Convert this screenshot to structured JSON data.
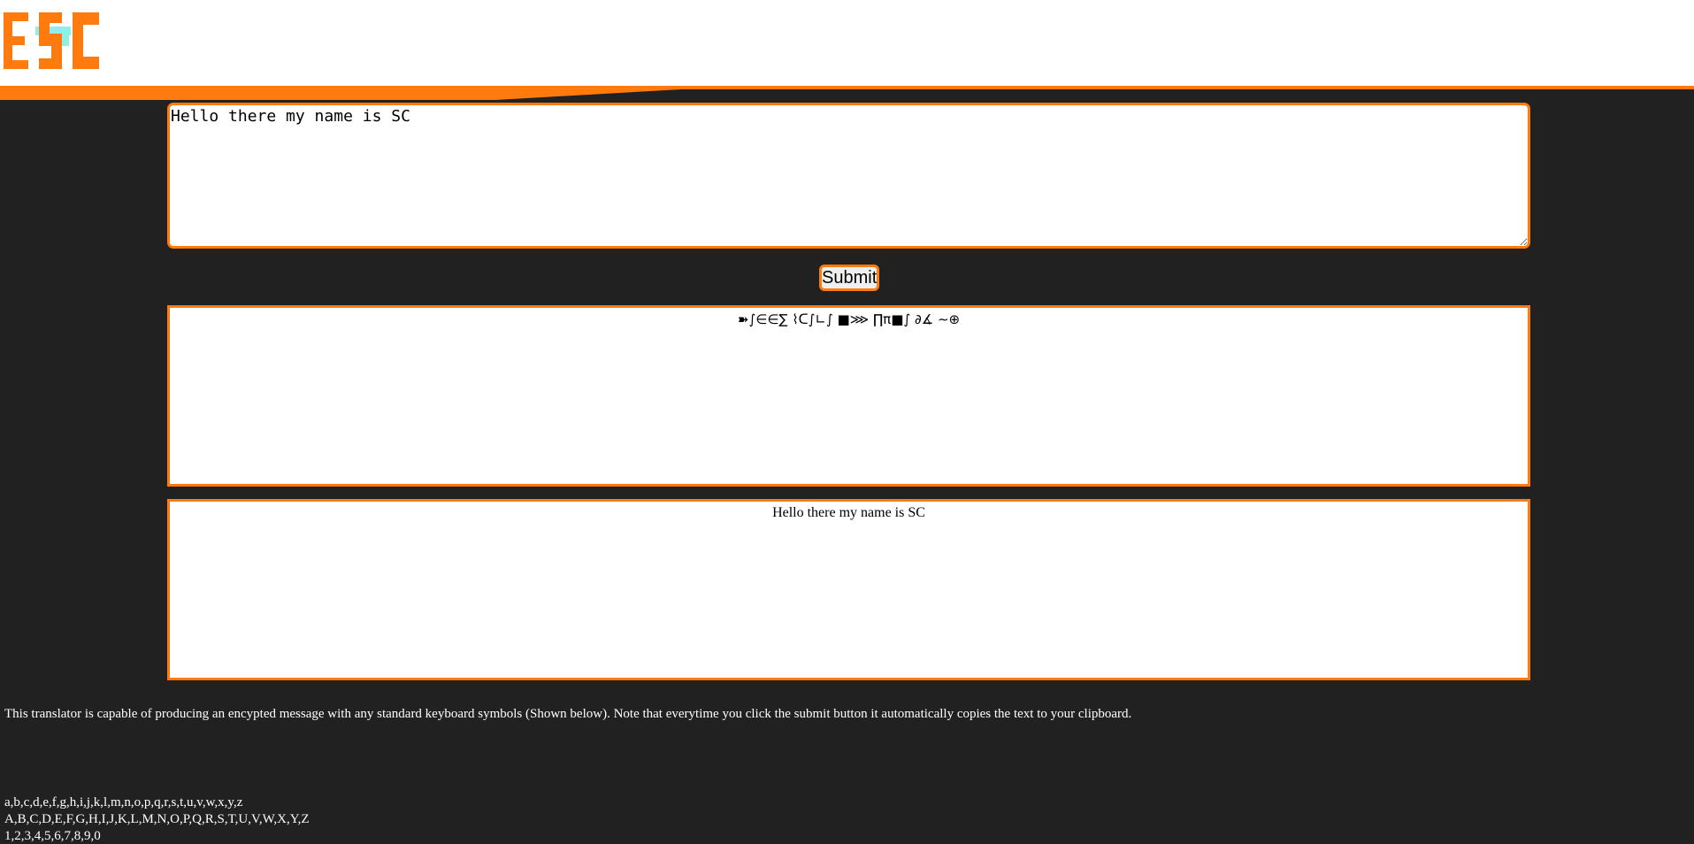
{
  "header": {
    "logo_text": "ESC",
    "colors": {
      "accent": "#ff7b0f",
      "logo_shadow": "#8ff0e6",
      "background": "#212121"
    }
  },
  "translator": {
    "input_value": "Hello there my name is SC",
    "submit_label": "Submit",
    "encrypted_output": "➽∫∈∈∑ ⌇ᑕ∫∟∫ ■⋙ ∏π■∫ ∂∡ ∼⊕",
    "decrypted_output": "Hello there my name is SC"
  },
  "info": {
    "description": "This translator is capable of producing an encypted message with any standard keyboard symbols (Shown below). Note that everytime you click the submit button it automatically copies the text to your clipboard.",
    "lowercase": "a,b,c,d,e,f,g,h,i,j,k,l,m,n,o,p,q,r,s,t,u,v,w,x,y,z",
    "uppercase": "A,B,C,D,E,F,G,H,I,J,K,L,M,N,O,P,Q,R,S,T,U,V,W,X,Y,Z",
    "digits": "1,2,3,4,5,6,7,8,9,0"
  }
}
